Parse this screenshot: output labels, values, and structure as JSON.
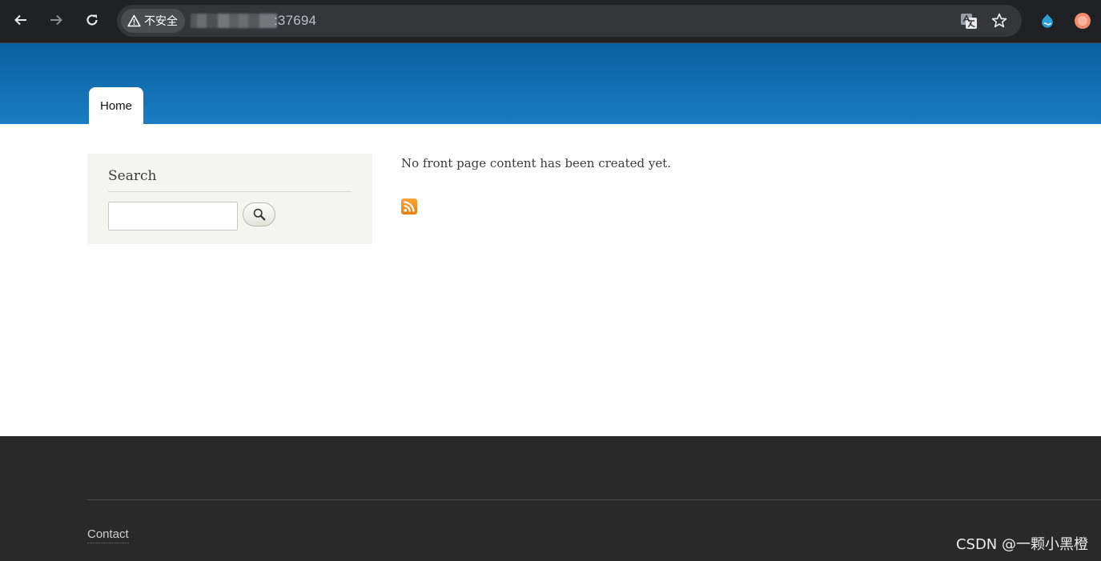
{
  "browser": {
    "security_label": "不安全",
    "url_suffix": ":37694",
    "colors": {
      "toolbar": "#202124",
      "omnibox": "#35363a"
    },
    "icons": [
      "back-arrow-icon",
      "forward-arrow-icon",
      "reload-icon",
      "warning-triangle-icon",
      "translate-icon",
      "bookmark-star-icon",
      "drupal-extension-icon",
      "profile-avatar-icon"
    ]
  },
  "header": {
    "nav_tab": "Home",
    "colors": {
      "gradient_top": "#0a5f9e",
      "gradient_bottom": "#1a7dc2"
    }
  },
  "sidebar": {
    "search": {
      "title": "Search",
      "input_value": "",
      "button_icon": "magnifier-icon"
    }
  },
  "main": {
    "message": "No front page content has been created yet.",
    "feed_icon": "rss-feed-icon"
  },
  "footer": {
    "links": [
      "Contact"
    ],
    "colors": {
      "background": "#292929"
    }
  },
  "watermark": "CSDN @一颗小黑橙"
}
